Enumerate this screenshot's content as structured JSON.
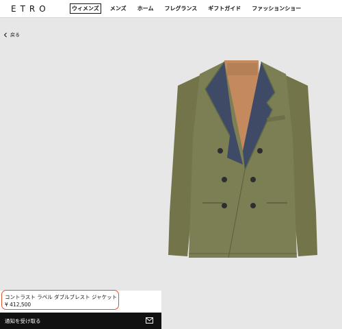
{
  "header": {
    "logo": "ETRO",
    "nav": [
      {
        "label": "ウィメンズ",
        "active": true
      },
      {
        "label": "メンズ",
        "active": false
      },
      {
        "label": "ホーム",
        "active": false
      },
      {
        "label": "フレグランス",
        "active": false
      },
      {
        "label": "ギフトガイド",
        "active": false
      },
      {
        "label": "ファッションショー",
        "active": false
      }
    ]
  },
  "back": {
    "label": "戻る",
    "icon": "chevron-left-icon"
  },
  "product": {
    "name": "コントラスト ラペル ダブルブレスト ジャケット",
    "price": "¥ 412,500",
    "image": "double-breasted-jacket-image",
    "colors": {
      "jacket": "#7c7e54",
      "lapel": "#3f4a66",
      "lining": "#c48a5e"
    }
  },
  "notify": {
    "label": "通知を受け取る",
    "icon": "mail-icon"
  },
  "annotation_color": "#e2502b"
}
